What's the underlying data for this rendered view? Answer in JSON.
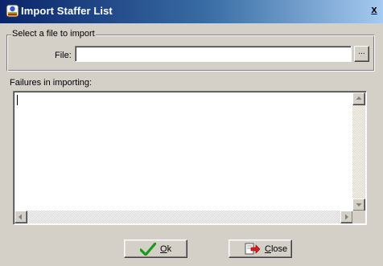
{
  "window": {
    "title": "Import Staffer List",
    "close_glyph": "x"
  },
  "file_group": {
    "legend": "Select a file to import",
    "file_label": "File:",
    "file_value": "",
    "browse_label": "..."
  },
  "failures": {
    "label": "Failures in importing:",
    "content": ""
  },
  "buttons": {
    "ok_label": "Ok",
    "close_label": "Close"
  },
  "icons": {
    "app": "staffer-app-icon",
    "ok": "checkmark-icon",
    "close": "door-exit-arrow-icon"
  },
  "colors": {
    "title_start": "#0a246a",
    "title_end": "#a6caf0",
    "face": "#d4d0c8",
    "check_green": "#1a9a1a",
    "exit_arrow_red": "#d42020"
  }
}
